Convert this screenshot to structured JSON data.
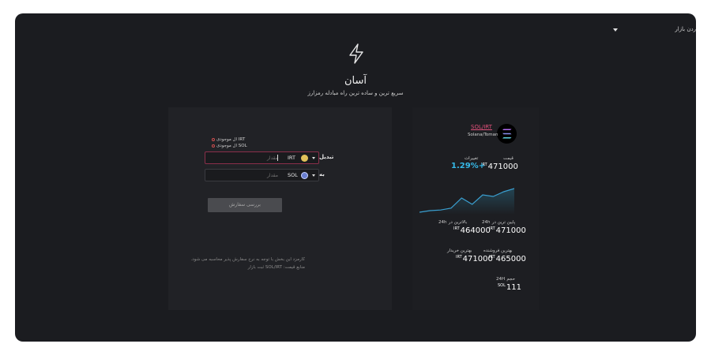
{
  "topbar": {
    "market_label": "ردن بازار"
  },
  "brand": {
    "title": "آسان",
    "subtitle": "سریع ترین و ساده ترین راه مبادله رمزارز"
  },
  "exchange": {
    "available_irt": "ال موجودی IRT",
    "available_sol": "ال موجودی SOL",
    "from_label": "تبدیل",
    "to_label": "به",
    "from_currency": "IRT",
    "to_currency": "SOL",
    "amount_placeholder": "مقدار",
    "review_button": "بررسی سفارش",
    "note_line1": "کارمزد این بخش با توجه به نرخ سفارش پذیر محاسبه می شود.",
    "note_line2": "منابع قیمت: SOL/IRT ثبت بازار"
  },
  "market": {
    "pair": "SOL/IRT",
    "pair_name": "Solana/Toman",
    "price_label": "قیمت",
    "change_label": "تغییرات",
    "price": "471000",
    "price_unit": "IRT",
    "change": "1.29%+",
    "high_label": "بالاترین در 24h",
    "low_label": "پایین ترین در 24h",
    "high_value": "471000",
    "low_value": "464000",
    "best_buy_label": "بهترین خریدار",
    "best_sell_label": "بهترین فروشنده",
    "best_buy_value": "465000",
    "best_sell_value": "471000",
    "volume_label": "حجم 24H",
    "volume_value": "111",
    "volume_unit": "SOL",
    "accent_color": "#35b9e8",
    "link_color": "#e0507a",
    "sparkline": [
      463500,
      464000,
      464200,
      464800,
      468000,
      466000,
      469000,
      468500,
      470000,
      471000
    ]
  },
  "icons": {
    "logo": "lightning-bolt-icon",
    "sol": "solana-icon",
    "irt": "toman-coin-icon"
  }
}
